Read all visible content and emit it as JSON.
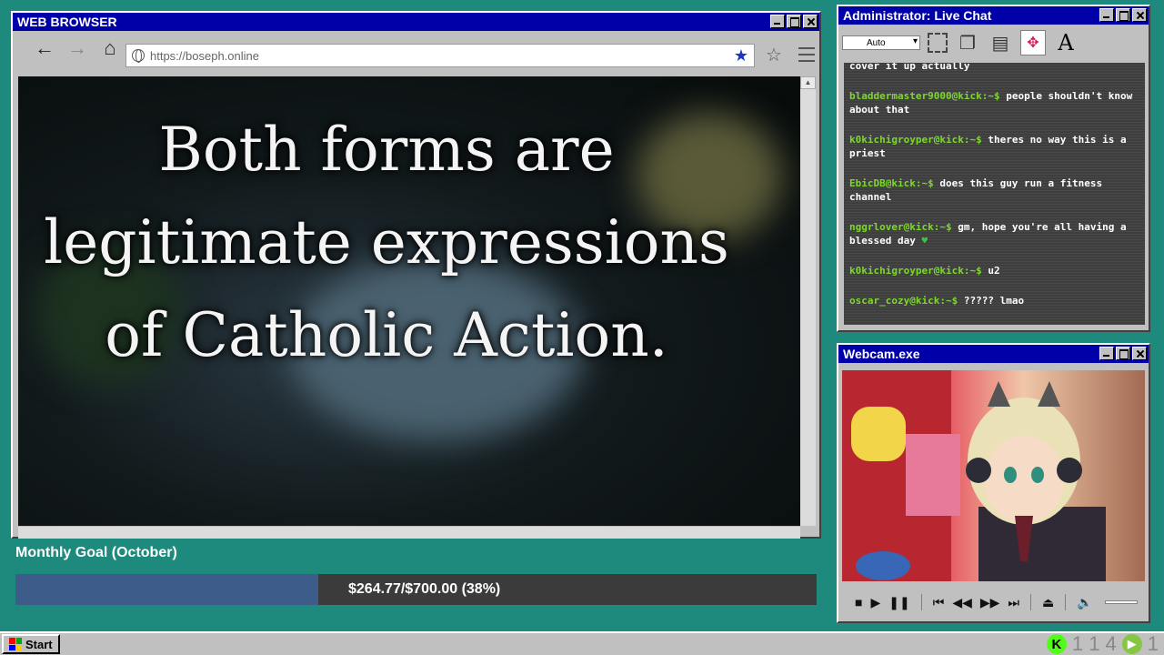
{
  "browser": {
    "title": "WEB BROWSER",
    "back_icon": "←",
    "forward_icon": "→",
    "home_icon": "⌂",
    "url": "https://boseph.online",
    "bookmark_filled_icon": "★",
    "bookmark_icon": "☆",
    "page_caption": "Both forms are legitimate expressions of Catholic Action."
  },
  "goal": {
    "label": "Monthly Goal (October)",
    "amount_text": "$264.77/$700.00 (38%)",
    "progress_fraction": 0.38,
    "fill_color": "#3d5c8a"
  },
  "chat": {
    "title": "Administrator: Live Chat",
    "select_value": "Auto",
    "partial_top": "cover it up actually",
    "messages": [
      {
        "user": "bladdermaster9000@kick:~$",
        "text": " people shouldn't know about that"
      },
      {
        "user": "k0kichigroyper@kick:~$",
        "text": " theres no way this is a priest"
      },
      {
        "user": "EbicDB@kick:~$",
        "text": " does this guy run a fitness channel"
      },
      {
        "user": "nggrlover@kick:~$",
        "text": " gm, hope you're all having a blessed day "
      },
      {
        "user": "k0kichigroyper@kick:~$",
        "text": " u2"
      },
      {
        "user": "oscar_cozy@kick:~$",
        "text": " ????? lmao"
      }
    ],
    "heart_icon": "♥",
    "user_color": "#7cd82c"
  },
  "webcam": {
    "title": "Webcam.exe",
    "controls": [
      "■",
      "▶",
      "❚❚",
      "⏮",
      "◀◀",
      "▶▶",
      "⏭",
      "⏏",
      "🔈"
    ]
  },
  "taskbar": {
    "start_label": "Start",
    "kick_icon": "K",
    "count_a": "1 1",
    "count_b": "4",
    "count_c": "1",
    "rumble_icon": "▶"
  }
}
